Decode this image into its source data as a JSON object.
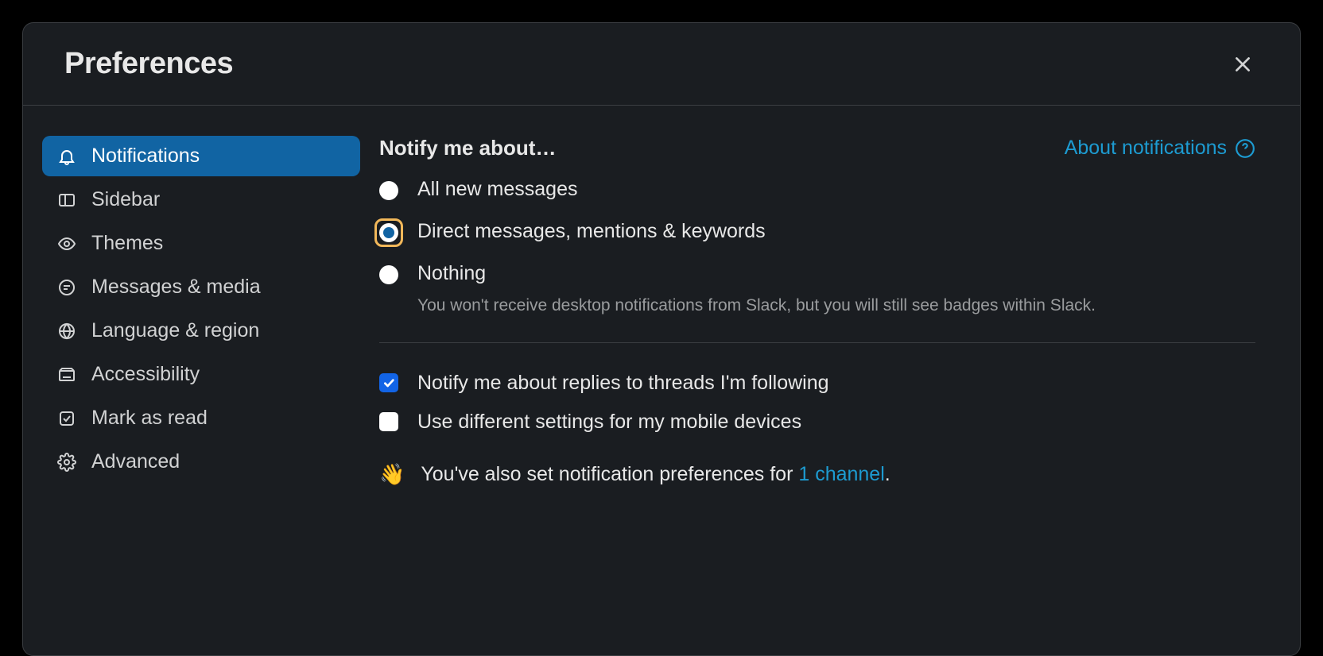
{
  "modal": {
    "title": "Preferences"
  },
  "sidebar": {
    "items": [
      {
        "label": "Notifications"
      },
      {
        "label": "Sidebar"
      },
      {
        "label": "Themes"
      },
      {
        "label": "Messages & media"
      },
      {
        "label": "Language & region"
      },
      {
        "label": "Accessibility"
      },
      {
        "label": "Mark as read"
      },
      {
        "label": "Advanced"
      }
    ]
  },
  "content": {
    "section_title": "Notify me about…",
    "help_link": "About notifications",
    "radios": [
      {
        "label": "All new messages"
      },
      {
        "label": "Direct messages, mentions & keywords"
      },
      {
        "label": "Nothing",
        "sub": "You won't receive desktop notifications from Slack, but you will still see badges within Slack."
      }
    ],
    "checks": [
      {
        "label": "Notify me about replies to threads I'm following"
      },
      {
        "label": "Use different settings for my mobile devices"
      }
    ],
    "note_prefix": "You've also set notification preferences for ",
    "note_link": "1 channel",
    "note_suffix": "."
  }
}
